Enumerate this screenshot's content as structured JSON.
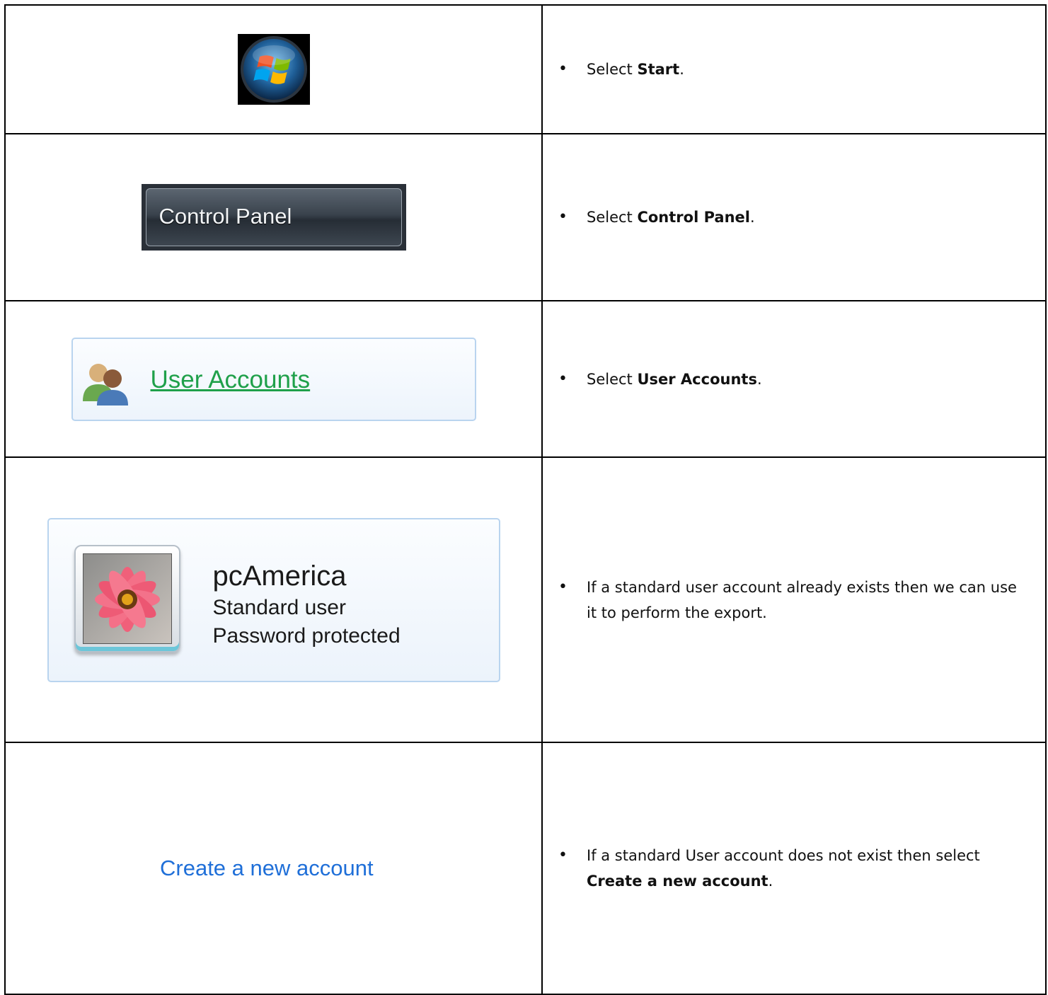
{
  "rows": [
    {
      "image": {
        "type": "start-orb",
        "icon": "windows-start-orb-icon"
      },
      "instruction": {
        "prefix": "Select ",
        "bold": "Start",
        "suffix": "."
      }
    },
    {
      "image": {
        "type": "button",
        "label": "Control Panel"
      },
      "instruction": {
        "prefix": "Select ",
        "bold": "Control Panel",
        "suffix": "."
      }
    },
    {
      "image": {
        "type": "link",
        "label": "User Accounts",
        "icon": "user-accounts-icon"
      },
      "instruction": {
        "prefix": "Select ",
        "bold": "User Accounts",
        "suffix": "."
      }
    },
    {
      "image": {
        "type": "account-tile",
        "name": "pcAmerica",
        "role": "Standard user",
        "status": "Password protected",
        "icon": "flower-avatar-icon"
      },
      "instruction": {
        "prefix": "If a standard user account already exists then we can use it to perform the export.",
        "bold": "",
        "suffix": ""
      }
    },
    {
      "image": {
        "type": "link",
        "label": "Create a new account"
      },
      "instruction": {
        "prefix": "If a standard User account does not exist then select ",
        "bold": "Create a new account",
        "suffix": "."
      }
    }
  ],
  "bullet": "•",
  "colors": {
    "link_green": "#1fa04a",
    "link_blue": "#1f6fd8",
    "tile_border": "#b9d4ef"
  }
}
